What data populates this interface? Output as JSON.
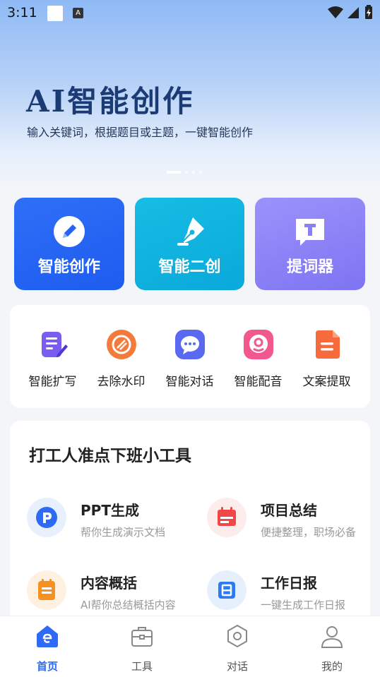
{
  "status_bar": {
    "time": "3:11"
  },
  "banner": {
    "title": "AI智能创作",
    "subtitle": "输入关键词，根据题目或主题，一键智能创作",
    "page_indicator": {
      "count": 4,
      "active": 0
    }
  },
  "feature_cards": [
    {
      "label": "智能创作",
      "icon": "pencil-icon",
      "color": "#2563f4"
    },
    {
      "label": "智能二创",
      "icon": "pen-nib-icon",
      "color": "#10b4e0"
    },
    {
      "label": "提词器",
      "icon": "prompter-icon",
      "color": "#8a80f6"
    }
  ],
  "tools": [
    {
      "label": "智能扩写",
      "icon": "expand-write-icon",
      "color": "#7b5cf0"
    },
    {
      "label": "去除水印",
      "icon": "remove-watermark-icon",
      "color": "#f37a3a"
    },
    {
      "label": "智能对话",
      "icon": "chat-icon",
      "color": "#5a6af0"
    },
    {
      "label": "智能配音",
      "icon": "dubbing-icon",
      "color": "#f2588e"
    },
    {
      "label": "文案提取",
      "icon": "extract-text-icon",
      "color": "#f76a3c"
    }
  ],
  "work_tools": {
    "title": "打工人准点下班小工具",
    "items": [
      {
        "name": "PPT生成",
        "desc": "帮你生成演示文档",
        "icon": "ppt-icon",
        "color": "#2e6af5"
      },
      {
        "name": "项目总结",
        "desc": "便捷整理，职场必备",
        "icon": "calendar-icon",
        "color": "#f04848"
      },
      {
        "name": "内容概括",
        "desc": "AI帮你总结概括内容",
        "icon": "clipboard-icon",
        "color": "#f6901e"
      },
      {
        "name": "工作日报",
        "desc": "一键生成工作日报",
        "icon": "daily-report-icon",
        "color": "#2e7af0"
      }
    ]
  },
  "tab_bar": {
    "active": 0,
    "tabs": [
      {
        "label": "首页",
        "icon": "home-icon"
      },
      {
        "label": "工具",
        "icon": "toolbox-icon"
      },
      {
        "label": "对话",
        "icon": "chat-hexagon-icon"
      },
      {
        "label": "我的",
        "icon": "profile-icon"
      }
    ]
  }
}
